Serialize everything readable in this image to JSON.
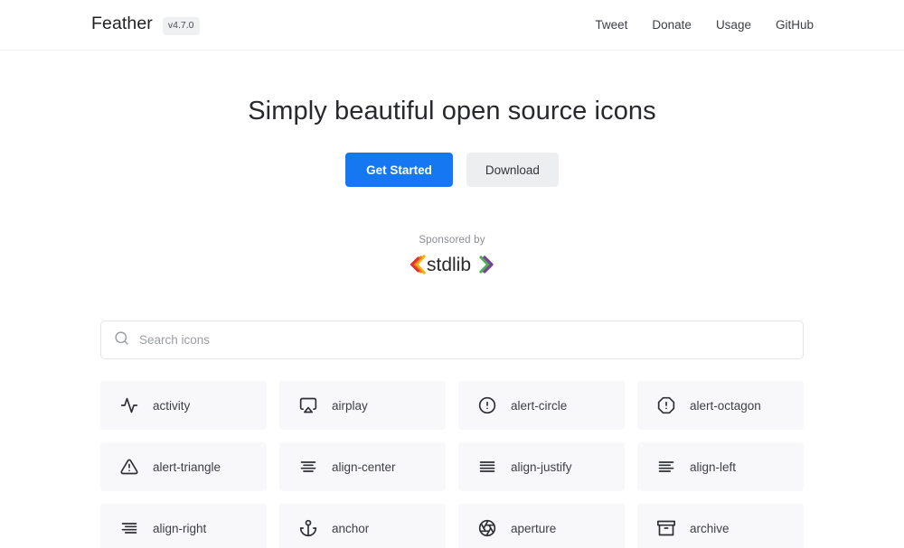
{
  "header": {
    "brand": "Feather",
    "version": "v4.7.0",
    "nav": [
      {
        "label": "Tweet",
        "name": "nav-link-tweet"
      },
      {
        "label": "Donate",
        "name": "nav-link-donate"
      },
      {
        "label": "Usage",
        "name": "nav-link-usage"
      },
      {
        "label": "GitHub",
        "name": "nav-link-github"
      }
    ]
  },
  "hero": {
    "title": "Simply beautiful open source icons",
    "primary_button": "Get Started",
    "secondary_button": "Download"
  },
  "sponsor": {
    "label": "Sponsored by",
    "logo_text": "stdlib"
  },
  "search": {
    "placeholder": "Search icons",
    "value": "",
    "icon": "search-icon"
  },
  "icons": [
    {
      "name": "activity",
      "glyph": "activity-icon"
    },
    {
      "name": "airplay",
      "glyph": "airplay-icon"
    },
    {
      "name": "alert-circle",
      "glyph": "alert-circle-icon"
    },
    {
      "name": "alert-octagon",
      "glyph": "alert-octagon-icon"
    },
    {
      "name": "alert-triangle",
      "glyph": "alert-triangle-icon"
    },
    {
      "name": "align-center",
      "glyph": "align-center-icon"
    },
    {
      "name": "align-justify",
      "glyph": "align-justify-icon"
    },
    {
      "name": "align-left",
      "glyph": "align-left-icon"
    },
    {
      "name": "align-right",
      "glyph": "align-right-icon"
    },
    {
      "name": "anchor",
      "glyph": "anchor-icon"
    },
    {
      "name": "aperture",
      "glyph": "aperture-icon"
    },
    {
      "name": "archive",
      "glyph": "archive-icon"
    }
  ],
  "colors": {
    "primary_button": "#1578f2",
    "secondary_button": "#eceef0",
    "card_background": "#f8f8fa",
    "text": "#3c3f44"
  }
}
